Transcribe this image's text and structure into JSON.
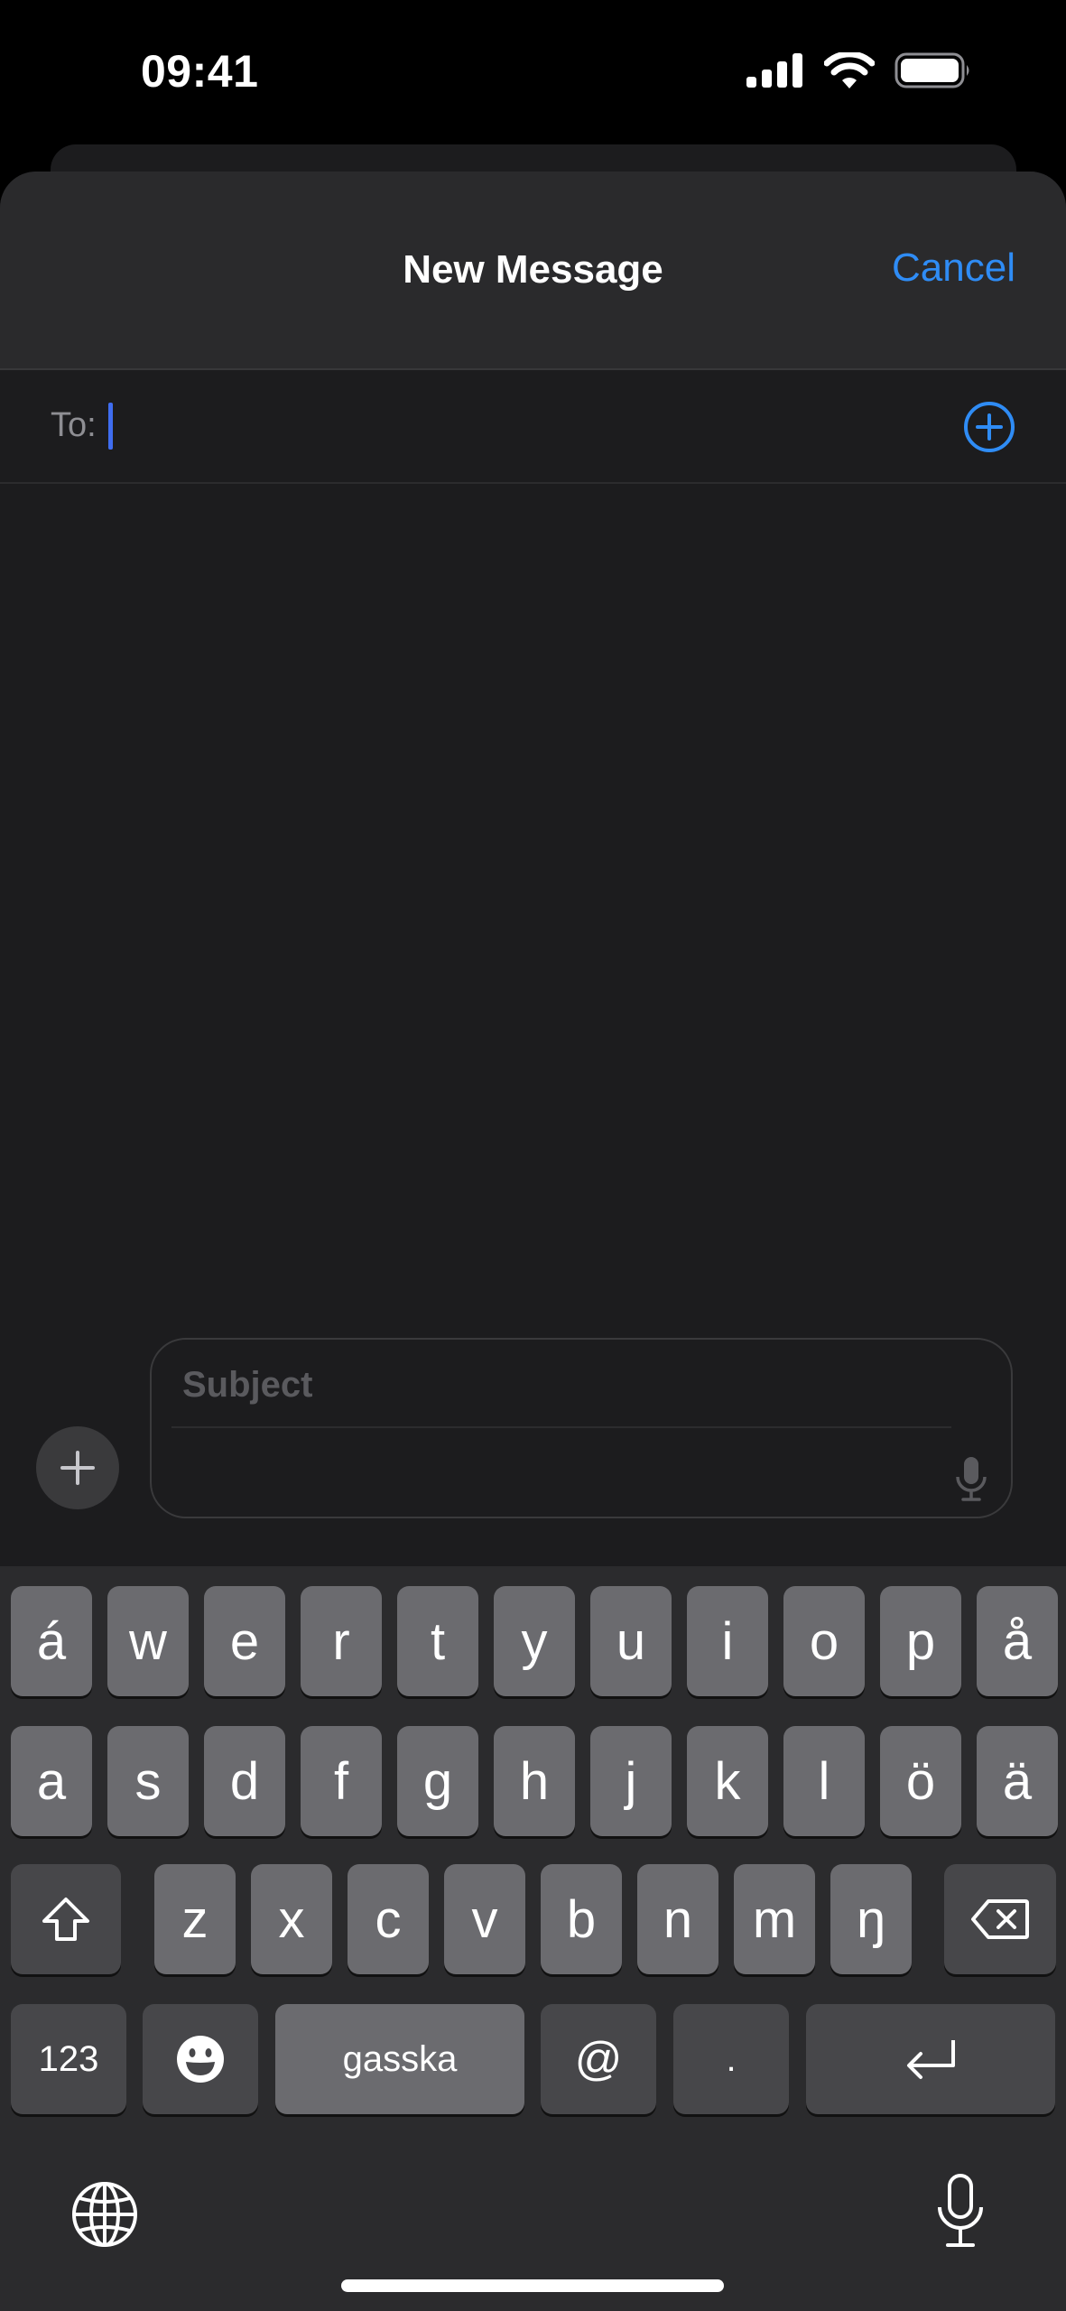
{
  "status_bar": {
    "time": "09:41"
  },
  "header": {
    "title": "New Message",
    "cancel_label": "Cancel"
  },
  "to_field": {
    "label": "To:",
    "value": ""
  },
  "compose": {
    "subject_placeholder": "Subject",
    "body_value": ""
  },
  "keyboard": {
    "row1": [
      "á",
      "w",
      "e",
      "r",
      "t",
      "y",
      "u",
      "i",
      "o",
      "p",
      "å"
    ],
    "row2": [
      "a",
      "s",
      "d",
      "f",
      "g",
      "h",
      "j",
      "k",
      "l",
      "ö",
      "ä"
    ],
    "row3": [
      "z",
      "x",
      "c",
      "v",
      "b",
      "n",
      "m",
      "ŋ"
    ],
    "numbers_label": "123",
    "space_label": "gasska",
    "at_label": "@",
    "period_label": "."
  },
  "colors": {
    "accent": "#2f8cf5",
    "caret": "#3f6df0",
    "sheet_bg": "#1c1c1e",
    "key_bg": "#6b6b6f",
    "fn_key_bg": "#47474a"
  },
  "icons": [
    "signal-icon",
    "wifi-icon",
    "battery-icon",
    "add-contact-icon",
    "plus-icon",
    "microphone-icon",
    "shift-icon",
    "delete-icon",
    "emoji-icon",
    "return-icon",
    "globe-icon"
  ]
}
